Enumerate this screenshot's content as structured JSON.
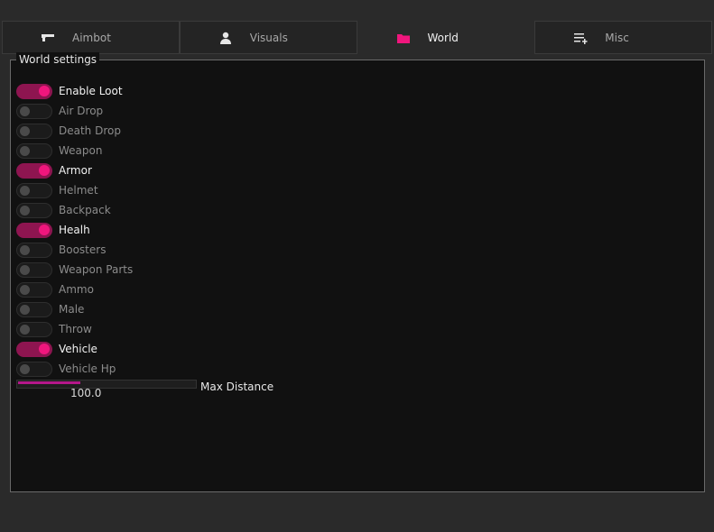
{
  "tabs": [
    {
      "label": "Aimbot",
      "icon": "gun-icon",
      "active": false
    },
    {
      "label": "Visuals",
      "icon": "person-icon",
      "active": false
    },
    {
      "label": "World",
      "icon": "folder-icon",
      "active": true
    },
    {
      "label": "Misc",
      "icon": "list-add-icon",
      "active": false
    }
  ],
  "panel": {
    "title": "World settings",
    "toggles": [
      {
        "label": "Enable Loot",
        "on": true
      },
      {
        "label": "Air Drop",
        "on": false
      },
      {
        "label": "Death Drop",
        "on": false
      },
      {
        "label": "Weapon",
        "on": false
      },
      {
        "label": "Armor",
        "on": true
      },
      {
        "label": "Helmet",
        "on": false
      },
      {
        "label": "Backpack",
        "on": false
      },
      {
        "label": "Healh",
        "on": true
      },
      {
        "label": "Boosters",
        "on": false
      },
      {
        "label": "Weapon Parts",
        "on": false
      },
      {
        "label": "Ammo",
        "on": false
      },
      {
        "label": "Male",
        "on": false
      },
      {
        "label": "Throw",
        "on": false
      },
      {
        "label": "Vehicle",
        "on": true
      },
      {
        "label": "Vehicle Hp",
        "on": false
      }
    ],
    "slider": {
      "label": "Max Distance",
      "value": "100.0",
      "fill_fraction": 0.35
    }
  },
  "colors": {
    "accent": "#f0167d",
    "accent_track": "#8e1550",
    "slider_fill": "#b4178a"
  }
}
